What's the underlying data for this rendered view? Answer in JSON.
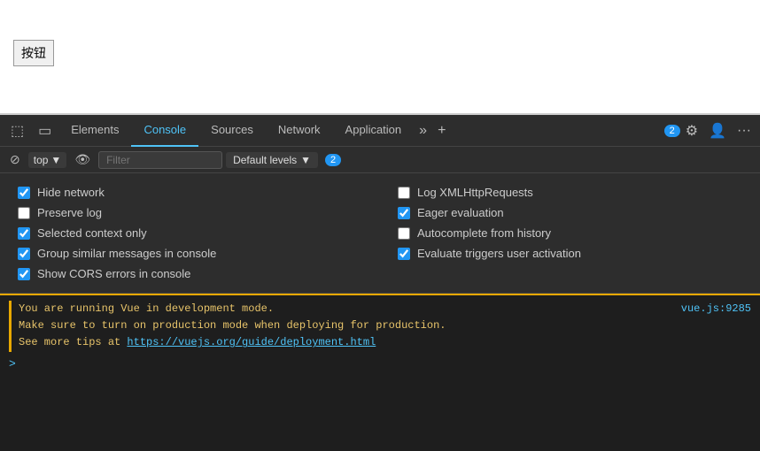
{
  "browser": {
    "button_label": "按钮"
  },
  "devtools": {
    "tabs": [
      {
        "label": "Elements",
        "active": false
      },
      {
        "label": "Console",
        "active": true
      },
      {
        "label": "Sources",
        "active": false
      },
      {
        "label": "Network",
        "active": false
      },
      {
        "label": "Application",
        "active": false
      }
    ],
    "more_tabs_icon": "»",
    "add_tab_icon": "+",
    "badge_count": "2",
    "settings_icon": "⚙",
    "profile_icon": "👤",
    "more_icon": "···"
  },
  "console_toolbar": {
    "clear_label": "🚫",
    "context_label": "top",
    "context_arrow": "▼",
    "watch_icon": "👁",
    "filter_placeholder": "Filter",
    "levels_label": "Default levels",
    "levels_arrow": "▼",
    "errors_badge": "2"
  },
  "settings": {
    "col1": [
      {
        "label": "Hide network",
        "checked": true
      },
      {
        "label": "Preserve log",
        "checked": false
      },
      {
        "label": "Selected context only",
        "checked": true
      },
      {
        "label": "Group similar messages in console",
        "checked": true
      },
      {
        "label": "Show CORS errors in console",
        "checked": true
      }
    ],
    "col2": [
      {
        "label": "Log XMLHttpRequests",
        "checked": false
      },
      {
        "label": "Eager evaluation",
        "checked": true
      },
      {
        "label": "Autocomplete from history",
        "checked": false
      },
      {
        "label": "Evaluate triggers user activation",
        "checked": true
      }
    ]
  },
  "console_output": {
    "line1": "You are running Vue in development mode.",
    "line2": "Make sure to turn on production mode when deploying for production.",
    "line3_prefix": "See more tips at ",
    "line3_link": "https://vuejs.org/guide/deployment.html",
    "source": "vue.js:9285",
    "prompt": ">"
  }
}
